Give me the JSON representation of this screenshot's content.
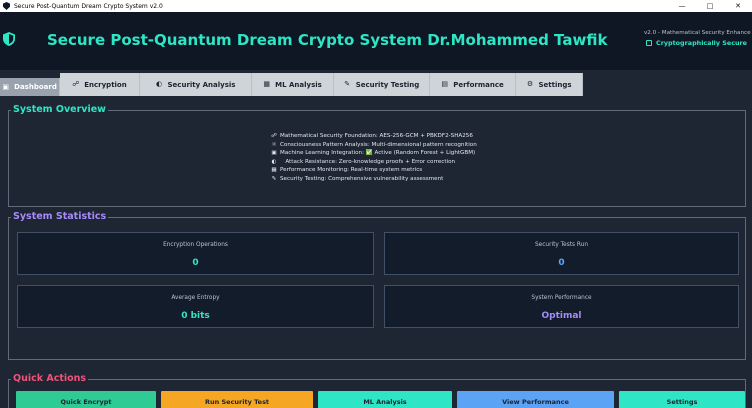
{
  "window": {
    "title": "Secure Post-Quantum Dream Crypto System v2.0",
    "controls": {
      "minimize": "—",
      "maximize": "□",
      "close": "✕"
    }
  },
  "header": {
    "title": "Secure Post-Quantum Dream Crypto System Dr.Mohammed Tawfik",
    "version": "v2.0 - Mathematical Security Enhance",
    "badge": "Cryptographically Secure"
  },
  "tabs": [
    {
      "label": "Dashboard",
      "icon": "dashboard-icon",
      "active": true
    },
    {
      "label": "Encryption",
      "icon": "lock-icon"
    },
    {
      "label": "Security Analysis",
      "icon": "shield-icon"
    },
    {
      "label": "ML Analysis",
      "icon": "chart-icon"
    },
    {
      "label": "Security Testing",
      "icon": "wrench-icon"
    },
    {
      "label": "Performance",
      "icon": "gauge-icon"
    },
    {
      "label": "Settings",
      "icon": "gear-icon"
    }
  ],
  "overview": {
    "heading": "System Overview",
    "features": [
      {
        "icon": "lock-icon",
        "text": "Mathematical Security Foundation: AES-256-GCM + PBKDF2-SHA256"
      },
      {
        "icon": "brain-icon",
        "text": "Consciousness Pattern Analysis: Multi-dimensional pattern recognition"
      },
      {
        "icon": "robot-icon",
        "text": "Machine Learning Integration: ✅ Active (Random Forest + LightGBM)"
      },
      {
        "icon": "shield-icon",
        "text": "   Attack Resistance: Zero-knowledge proofs + Error correction"
      },
      {
        "icon": "chart-icon",
        "text": "Performance Monitoring: Real-time system metrics"
      },
      {
        "icon": "wrench-icon",
        "text": "Security Testing: Comprehensive vulnerability assessment"
      }
    ]
  },
  "stats": {
    "heading": "System Statistics",
    "cards": [
      {
        "label": "Encryption Operations",
        "value": "0",
        "color": "#2ee6c5"
      },
      {
        "label": "Security Tests Run",
        "value": "0",
        "color": "#60a5fa"
      },
      {
        "label": "Average Entropy",
        "value": "0 bits",
        "color": "#2ee6c5"
      },
      {
        "label": "System Performance",
        "value": "Optimal",
        "color": "#a78bfa"
      }
    ]
  },
  "actions": {
    "heading": "Quick Actions",
    "buttons": [
      {
        "label": "Quick Encrypt",
        "color": "#2ecb95"
      },
      {
        "label": "Run Security Test",
        "color": "#f5a623"
      },
      {
        "label": "ML Analysis",
        "color": "#2ee6c5"
      },
      {
        "label": "View Performance",
        "color": "#5ba3f5"
      },
      {
        "label": "Settings",
        "color": "#2ee6c5"
      }
    ]
  }
}
